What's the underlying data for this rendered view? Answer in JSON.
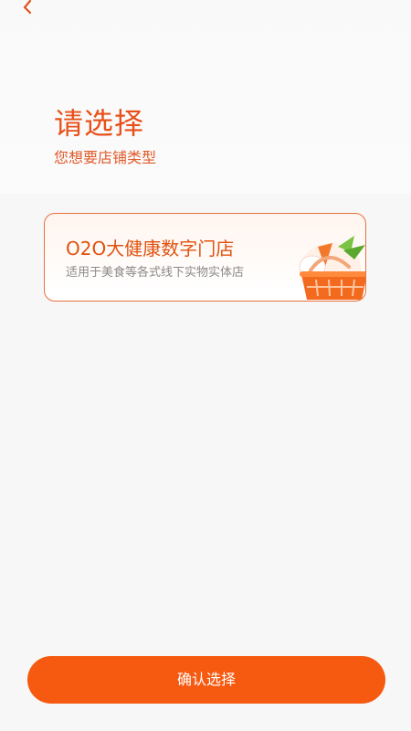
{
  "nav": {
    "back_icon": "chevron-left-icon"
  },
  "header": {
    "title": "请选择",
    "subtitle": "您想要店铺类型"
  },
  "store_options": [
    {
      "title": "O2O大健康数字门店",
      "description": "适用于美食等各式线下实物实体店",
      "icon": "shopping-basket-icon"
    }
  ],
  "footer": {
    "confirm_label": "确认选择"
  },
  "colors": {
    "accent": "#f65a10",
    "title": "#e8501a",
    "card_border": "#e9703e",
    "background": "#f7f7f7"
  }
}
